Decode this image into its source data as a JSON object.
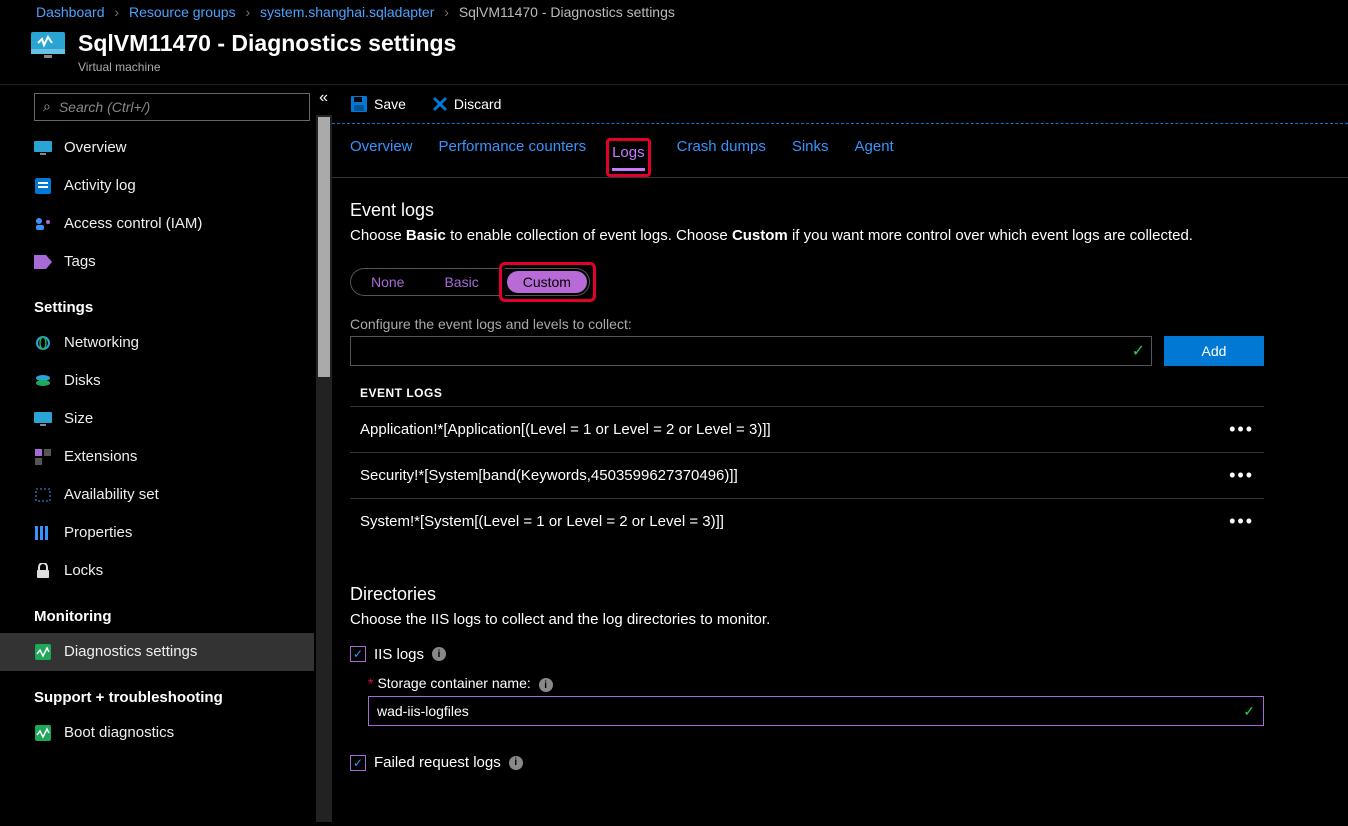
{
  "breadcrumb": {
    "items": [
      "Dashboard",
      "Resource groups",
      "system.shanghai.sqladapter",
      "SqlVM11470 - Diagnostics settings"
    ]
  },
  "header": {
    "title": "SqlVM11470 - Diagnostics settings",
    "subtitle": "Virtual machine"
  },
  "sidebar": {
    "search_placeholder": "Search (Ctrl+/)",
    "items": [
      {
        "icon": "monitor",
        "label": "Overview"
      },
      {
        "icon": "log",
        "label": "Activity log"
      },
      {
        "icon": "iam",
        "label": "Access control (IAM)"
      },
      {
        "icon": "tag",
        "label": "Tags"
      }
    ],
    "settings_header": "Settings",
    "settings": [
      {
        "icon": "net",
        "label": "Networking"
      },
      {
        "icon": "disk",
        "label": "Disks"
      },
      {
        "icon": "size",
        "label": "Size"
      },
      {
        "icon": "ext",
        "label": "Extensions"
      },
      {
        "icon": "avail",
        "label": "Availability set"
      },
      {
        "icon": "prop",
        "label": "Properties"
      },
      {
        "icon": "lock",
        "label": "Locks"
      }
    ],
    "monitoring_header": "Monitoring",
    "monitoring": [
      {
        "icon": "diag",
        "label": "Diagnostics settings",
        "active": true
      }
    ],
    "support_header": "Support + troubleshooting",
    "support": [
      {
        "icon": "boot",
        "label": "Boot diagnostics"
      }
    ]
  },
  "toolbar": {
    "save": "Save",
    "discard": "Discard"
  },
  "tabs": {
    "items": [
      "Overview",
      "Performance counters",
      "Logs",
      "Crash dumps",
      "Sinks",
      "Agent"
    ],
    "active": "Logs"
  },
  "logs": {
    "title": "Event logs",
    "desc_pre": "Choose ",
    "desc_b1": "Basic",
    "desc_mid": " to enable collection of event logs. Choose ",
    "desc_b2": "Custom",
    "desc_post": " if you want more control over which event logs are collected.",
    "toggle": [
      "None",
      "Basic",
      "Custom"
    ],
    "toggle_selected": "Custom",
    "configure_label": "Configure the event logs and levels to collect:",
    "add_button": "Add",
    "table_header": "EVENT LOGS",
    "rows": [
      "Application!*[Application[(Level = 1 or Level = 2 or Level = 3)]]",
      "Security!*[System[band(Keywords,4503599627370496)]]",
      "System!*[System[(Level = 1 or Level = 2 or Level = 3)]]"
    ]
  },
  "directories": {
    "title": "Directories",
    "desc": "Choose the IIS logs to collect and the log directories to monitor.",
    "iis_label": "IIS logs",
    "storage_label": "Storage container name:",
    "storage_value": "wad-iis-logfiles",
    "failed_label": "Failed request logs"
  }
}
